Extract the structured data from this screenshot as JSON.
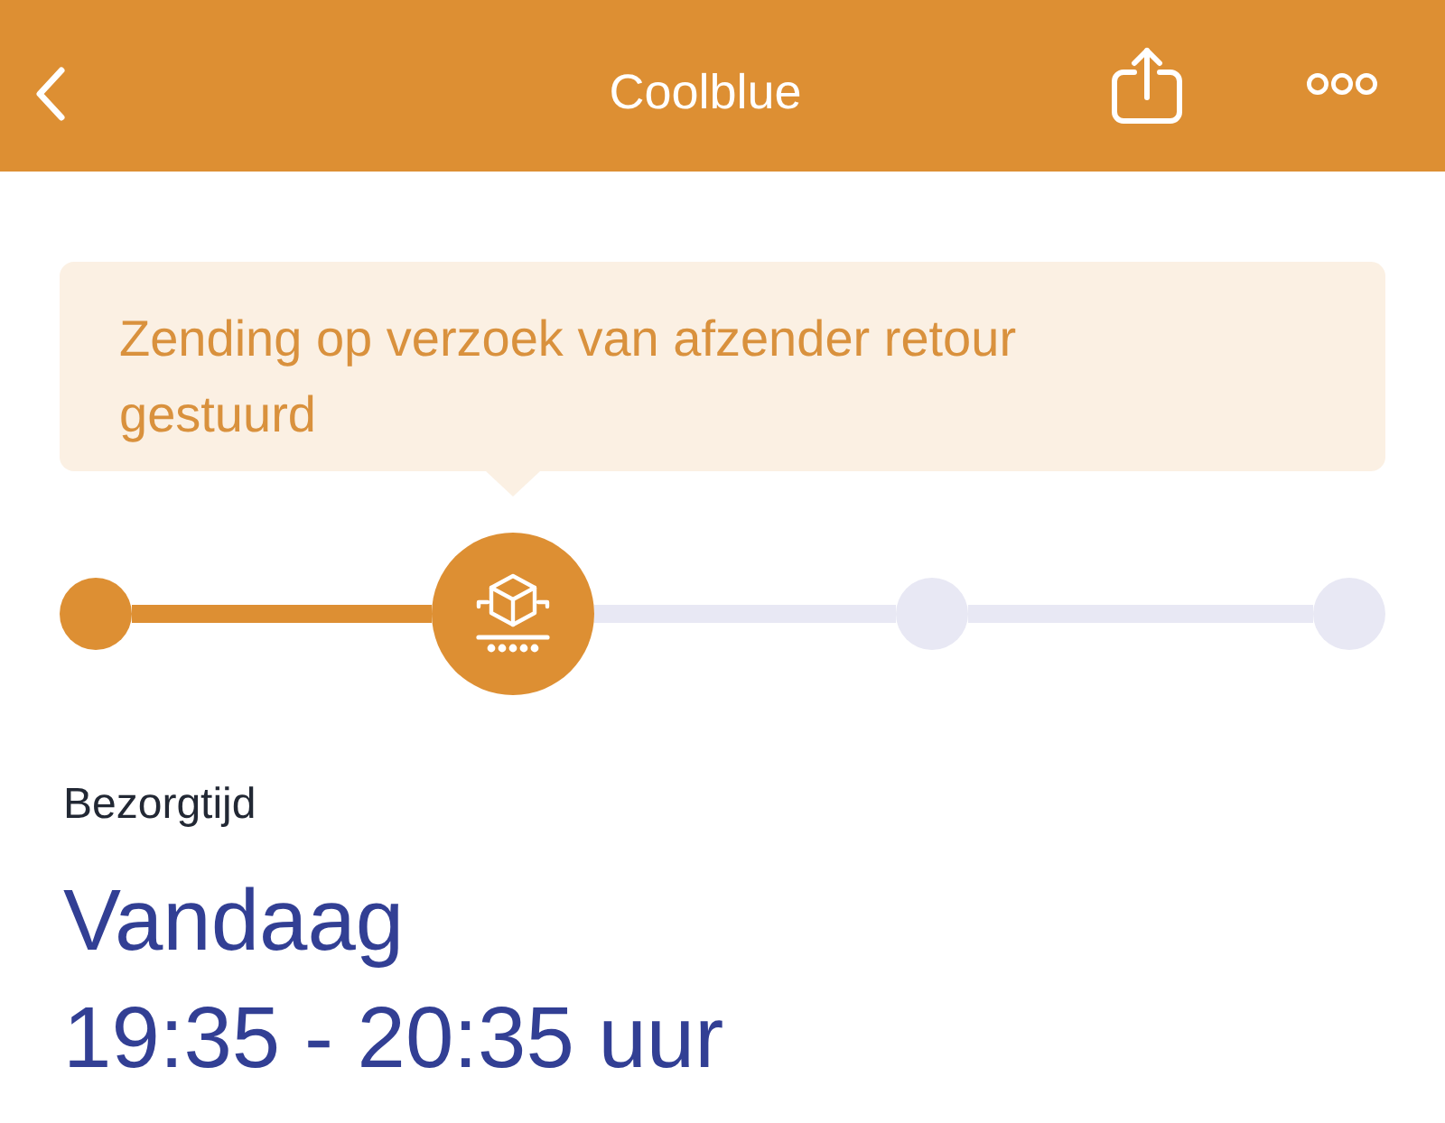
{
  "header": {
    "title": "Coolblue"
  },
  "notice": {
    "text": "Zending op verzoek van afzender retour gestuurd"
  },
  "steps": [
    {
      "kind": "done"
    },
    {
      "kind": "current"
    },
    {
      "kind": "pending"
    },
    {
      "kind": "pending"
    }
  ],
  "delivery": {
    "label": "Bezorgtijd",
    "day": "Vandaag",
    "time_window": "19:35 - 20:35 uur"
  }
}
